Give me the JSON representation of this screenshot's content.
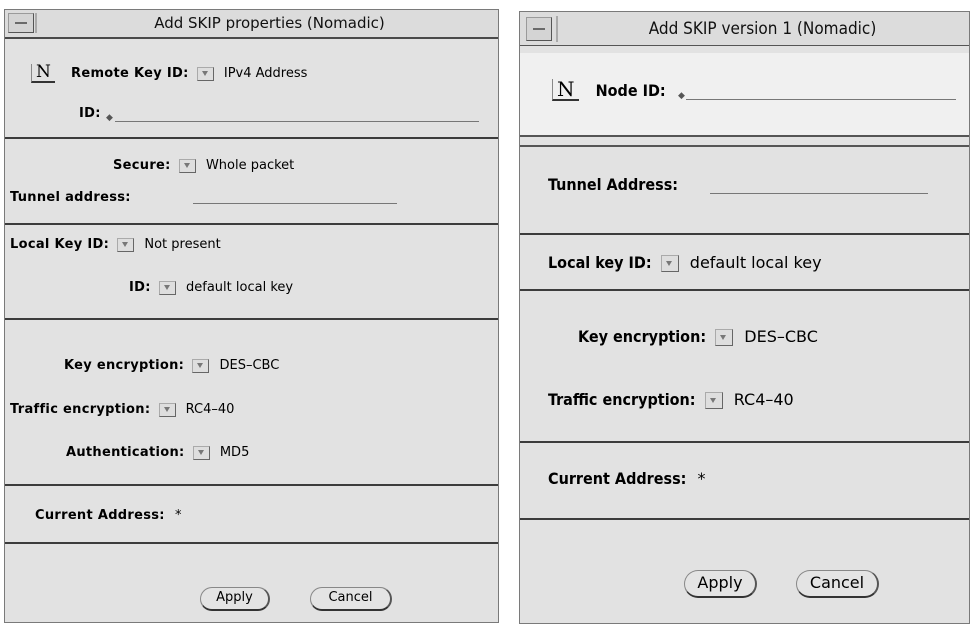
{
  "left": {
    "title": "Add SKIP properties (Nomadic)",
    "name_button": "N",
    "remote_key_label": "Remote Key ID:",
    "remote_key_value": "IPv4 Address",
    "id_label": "ID:",
    "secure_label": "Secure:",
    "secure_value": "Whole packet",
    "tunnel_label": "Tunnel address:",
    "local_key_label": "Local Key ID:",
    "local_key_value": "Not present",
    "local_id_label": "ID:",
    "local_id_value": "default local key",
    "key_enc_label": "Key encryption:",
    "key_enc_value": "DES–CBC",
    "traffic_enc_label": "Traffic encryption:",
    "traffic_enc_value": "RC4–40",
    "auth_label": "Authentication:",
    "auth_value": "MD5",
    "current_address_label": "Current Address:",
    "current_address_value": "*",
    "apply_label": "Apply",
    "cancel_label": "Cancel"
  },
  "right": {
    "title": "Add SKIP version 1 (Nomadic)",
    "name_button": "N",
    "node_id_label": "Node ID:",
    "tunnel_label": "Tunnel Address:",
    "local_key_label": "Local key ID:",
    "local_key_value": "default local key",
    "key_enc_label": "Key encryption:",
    "key_enc_value": "DES–CBC",
    "traffic_enc_label": "Traffic encryption:",
    "traffic_enc_value": "RC4–40",
    "current_address_label": "Current Address:",
    "current_address_value": "*",
    "apply_label": "Apply",
    "cancel_label": "Cancel"
  },
  "icons": {
    "window_menu": "window-menu-icon",
    "abbreviated_menu": "abbreviated-menu-button-icon",
    "text_caret": "text-caret-icon"
  }
}
